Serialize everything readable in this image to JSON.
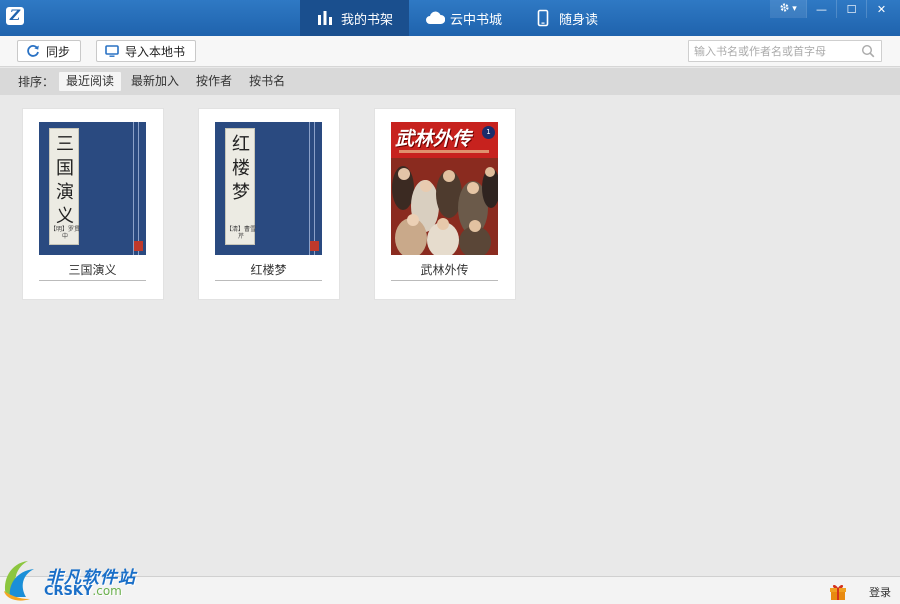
{
  "app": {
    "logo_text": "Z"
  },
  "nav": {
    "tabs": [
      {
        "label": "我的书架",
        "icon": "bar-chart-icon",
        "active": true
      },
      {
        "label": "云中书城",
        "icon": "cloud-icon",
        "active": false
      },
      {
        "label": "随身读",
        "icon": "phone-icon",
        "active": false
      }
    ]
  },
  "window_controls": {
    "settings_icon": "gear-icon",
    "settings_arrow": "▾",
    "minimize": "—",
    "maximize": "☐",
    "close": "✕"
  },
  "toolbar": {
    "sync_label": "同步",
    "import_label": "导入本地书",
    "search_placeholder": "输入书名或作者名或首字母"
  },
  "sortbar": {
    "label": "排序：",
    "options": [
      {
        "label": "最近阅读",
        "active": true
      },
      {
        "label": "最新加入",
        "active": false
      },
      {
        "label": "按作者",
        "active": false
      },
      {
        "label": "按书名",
        "active": false
      }
    ]
  },
  "books": [
    {
      "title": "三国演义",
      "cover_text": "三国演义",
      "cover_sub": "【明】罗贯中"
    },
    {
      "title": "红楼梦",
      "cover_text": "红楼梦",
      "cover_sub": "【清】曹雪芹"
    },
    {
      "title": "武林外传",
      "cover_text": "武林外传",
      "cover_badge": "1"
    }
  ],
  "statusbar": {
    "login_label": "登录",
    "gift_icon": "gift-icon"
  },
  "watermark": {
    "cn": "非凡软件站",
    "en": "CRSKY",
    "domain": ".com"
  },
  "colors": {
    "titlebar": "#2f79c4",
    "active_tab": "#1a4f8e",
    "trad_cover": "#2a4a80",
    "wulin_cover": "#c7221e"
  }
}
